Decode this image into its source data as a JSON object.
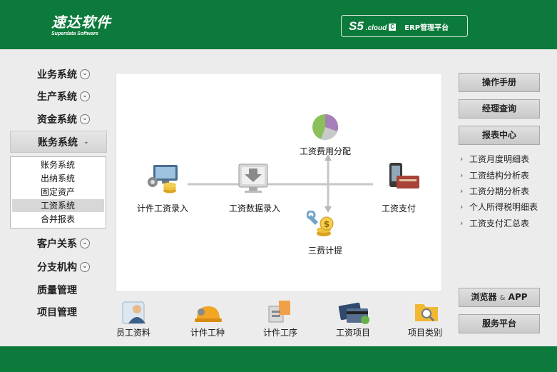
{
  "header": {
    "logo_text": "速达软件",
    "logo_sub": "Superdata Software",
    "brand_s5": "S5",
    "brand_cloud": ".cloud",
    "brand_c": "C",
    "brand_erp": "ERP管理平台"
  },
  "nav": {
    "items": [
      {
        "label": "业务系统"
      },
      {
        "label": "生产系统"
      },
      {
        "label": "资金系统"
      },
      {
        "label": "账务系统"
      },
      {
        "label": "客户关系"
      },
      {
        "label": "分支机构"
      },
      {
        "label": "质量管理"
      },
      {
        "label": "项目管理"
      }
    ],
    "sub_items": [
      "账务系统",
      "出纳系统",
      "固定资产",
      "工资系统",
      "合并报表"
    ],
    "selected_sub": "工资系统"
  },
  "flow": {
    "piecework_entry": "计件工资录入",
    "wage_data_entry": "工资数据录入",
    "wage_payment": "工资支付",
    "wage_cost_alloc": "工资费用分配",
    "three_fees": "三费计提"
  },
  "bottom": {
    "employee": "员工资料",
    "piece_type": "计件工种",
    "piece_process": "计件工序",
    "wage_item": "工资项目",
    "item_category": "项目类别"
  },
  "right": {
    "manual": "操作手册",
    "manager_query": "经理查询",
    "report_center": "报表中心",
    "reports": [
      "工资月度明细表",
      "工资结构分析表",
      "工资分期分析表",
      "个人所得税明细表",
      "工资支付汇总表"
    ],
    "browser": "浏览器",
    "amp": "&",
    "app": "APP",
    "service": "服务平台"
  },
  "colors": {
    "brand_green": "#0c7a3b",
    "page_bg": "#ececec",
    "panel_bg": "#ffffff"
  },
  "icons": [
    "down-chevron-icon",
    "computer-coins-icon",
    "download-monitor-icon",
    "pie-chart-icon",
    "wallet-phone-icon",
    "wrench-coins-icon",
    "employee-avatar-icon",
    "hardhat-icon",
    "process-tools-icon",
    "credit-cards-icon",
    "folder-search-icon"
  ]
}
